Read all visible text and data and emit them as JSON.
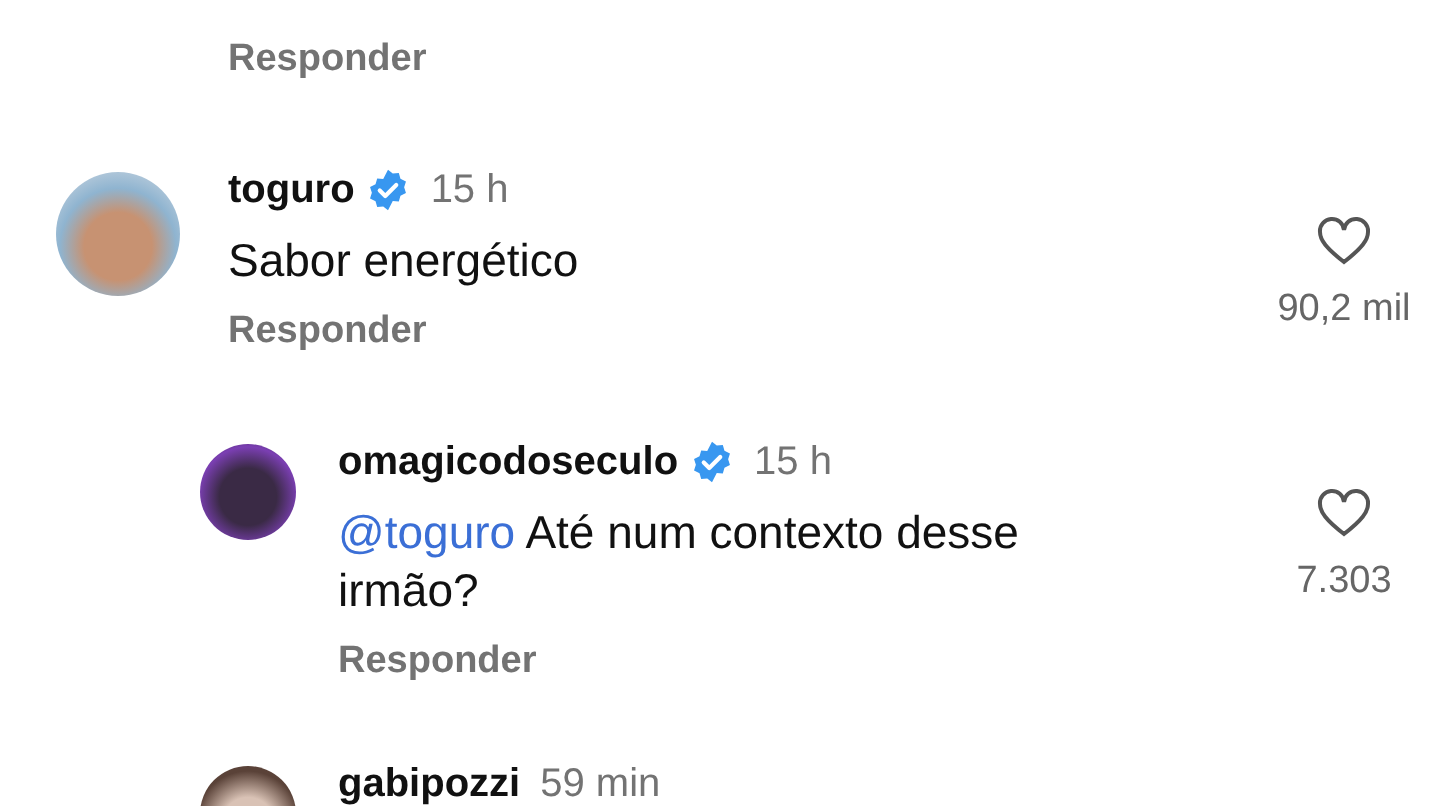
{
  "previous_comment": {
    "reply_action": "Responder"
  },
  "comments": [
    {
      "username": "toguro",
      "verified": true,
      "time": "15 h",
      "text": "Sabor energético",
      "reply_action": "Responder",
      "likes": "90,2 mil",
      "liked": false,
      "children": [
        {
          "username": "omagicodoseculo",
          "verified": true,
          "time": "15 h",
          "mention": "@toguro",
          "text": "Até num contexto desse irmão?",
          "reply_action": "Responder",
          "likes": "7.303",
          "liked": false
        },
        {
          "username": "gabipozzi",
          "verified": false,
          "time": "59 min"
        }
      ]
    }
  ]
}
